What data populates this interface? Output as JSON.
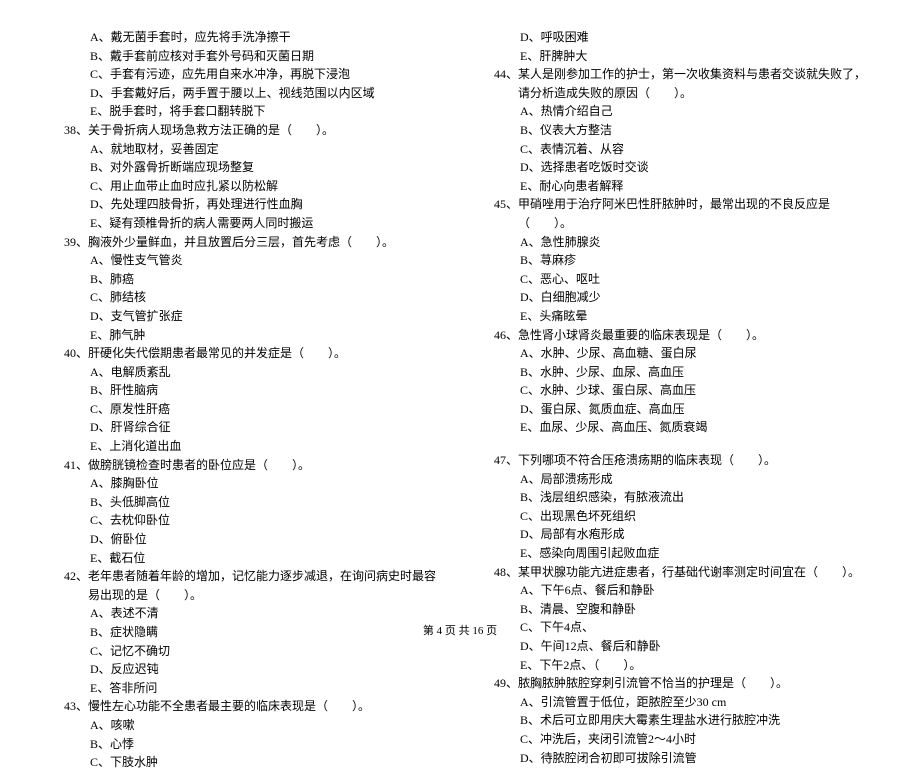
{
  "left": {
    "pre_opts": [
      "A、戴无菌手套时，应先将手洗净擦干",
      "B、戴手套前应核对手套外号码和灭菌日期",
      "C、手套有污迹，应先用自来水冲净，再脱下浸泡",
      "D、手套戴好后，两手置于腰以上、视线范围以内区域",
      "E、脱手套时，将手套口翻转脱下"
    ],
    "q38": {
      "stem": "38、关于骨折病人现场急救方法正确的是（　　）。",
      "opts": [
        "A、就地取材，妥善固定",
        "B、对外露骨折断端应现场整复",
        "C、用止血带止血时应扎紧以防松解",
        "D、先处理四肢骨折，再处理进行性血胸",
        "E、疑有颈椎骨折的病人需要两人同时搬运"
      ]
    },
    "q39": {
      "stem": "39、胸液外少量鲜血，并且放置后分三层，首先考虑（　　）。",
      "opts": [
        "A、慢性支气管炎",
        "B、肺癌",
        "C、肺结核",
        "D、支气管扩张症",
        "E、肺气肿"
      ]
    },
    "q40": {
      "stem": "40、肝硬化失代偿期患者最常见的并发症是（　　）。",
      "opts": [
        "A、电解质紊乱",
        "B、肝性脑病",
        "C、原发性肝癌",
        "D、肝肾综合征",
        "E、上消化道出血"
      ]
    },
    "q41": {
      "stem": "41、做膀胱镜检查时患者的卧位应是（　　）。",
      "opts": [
        "A、膝胸卧位",
        "B、头低脚高位",
        "C、去枕仰卧位",
        "D、俯卧位",
        "E、截石位"
      ]
    },
    "q42": {
      "stem": "42、老年患者随着年龄的增加，记忆能力逐步减退，在询问病史时最容易出现的是（　　）。",
      "opts": [
        "A、表述不清",
        "B、症状隐瞒",
        "C、记忆不确切",
        "D、反应迟钝",
        "E、答非所问"
      ]
    },
    "q43": {
      "stem": "43、慢性左心功能不全患者最主要的临床表现是（　　）。",
      "opts": [
        "A、咳嗽",
        "B、心悸",
        "C、下肢水肿"
      ]
    }
  },
  "right": {
    "pre_opts": [
      "D、呼吸困难",
      "E、肝脾肿大"
    ],
    "q44": {
      "stem": "44、某人是刚参加工作的护士，第一次收集资料与患者交谈就失败了，请分析造成失败的原因（　　）。",
      "opts": [
        "A、热情介绍自己",
        "B、仪表大方整洁",
        "C、表情沉着、从容",
        "D、选择患者吃饭时交谈",
        "E、耐心向患者解释"
      ]
    },
    "q45": {
      "stem": "45、甲硝唑用于治疗阿米巴性肝脓肿时，最常出现的不良反应是（　　）。",
      "opts": [
        "A、急性肺腺炎",
        "B、荨麻疹",
        "C、恶心、呕吐",
        "D、白细胞减少",
        "E、头痛眩晕"
      ]
    },
    "q46": {
      "stem": "46、急性肾小球肾炎最重要的临床表现是（　　）。",
      "opts": [
        "A、水肿、少尿、高血糖、蛋白尿",
        "B、水肿、少尿、血尿、高血压",
        "C、水肿、少球、蛋白尿、高血压",
        "D、蛋白尿、氮质血症、高血压",
        "E、血尿、少尿、高血压、氮质衰竭"
      ]
    },
    "q47": {
      "stem": "47、下列哪项不符合压疮溃疡期的临床表现（　　）。",
      "opts": [
        "A、局部溃疡形成",
        "B、浅层组织感染，有脓液流出",
        "C、出现黑色坏死组织",
        "D、局部有水疱形成",
        "E、感染向周围引起败血症"
      ]
    },
    "q48": {
      "stem": "48、某甲状腺功能亢进症患者，行基础代谢率测定时间宜在（　　）。",
      "opts": [
        "A、下午6点、餐后和静卧",
        "B、清晨、空腹和静卧",
        "C、下午4点、",
        "D、午间12点、餐后和静卧",
        "E、下午2点、（　　）。"
      ]
    },
    "q49": {
      "stem": "49、脓胸脓肿脓腔穿刺引流管不恰当的护理是（　　）。",
      "opts": [
        "A、引流管置于低位，距脓腔至少30 cm",
        "B、术后可立即用庆大霉素生理盐水进行脓腔冲洗",
        "C、冲洗后，夹闭引流管2～4小时",
        "D、待脓腔闭合初即可拔除引流管"
      ]
    }
  },
  "footer": "第 4 页 共 16 页"
}
